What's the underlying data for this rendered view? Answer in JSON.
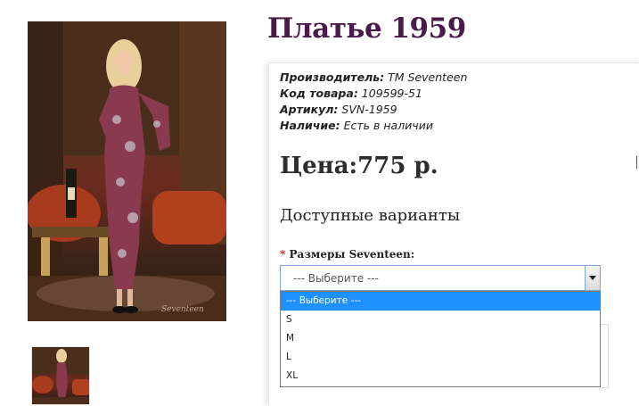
{
  "product": {
    "title": "Платье 1959",
    "info": [
      {
        "key": "Производитель:",
        "value": "TM Seventeen"
      },
      {
        "key": "Код товара:",
        "value": "109599-51"
      },
      {
        "key": "Артикул:",
        "value": "SVN-1959"
      },
      {
        "key": "Наличие:",
        "value": "Есть в наличии"
      }
    ],
    "price": "Цена:775 р.",
    "variants_heading": "Доступные варианты",
    "option": {
      "required_mark": "*",
      "label": "Размеры Seventeen:",
      "selected": "--- Выберите ---",
      "choices": [
        "--- Выберите ---",
        "S",
        "M",
        "L",
        "XL"
      ]
    }
  },
  "images": {
    "main_alt_icon": "dress-photo",
    "thumb_icon": "dress-thumbnail",
    "watermark": "Seventeen"
  },
  "colors": {
    "title": "#4a1a4a",
    "dropdown_highlight": "#1e90ff",
    "select_border": "#7aa7d8",
    "required": "#d41f1f"
  }
}
